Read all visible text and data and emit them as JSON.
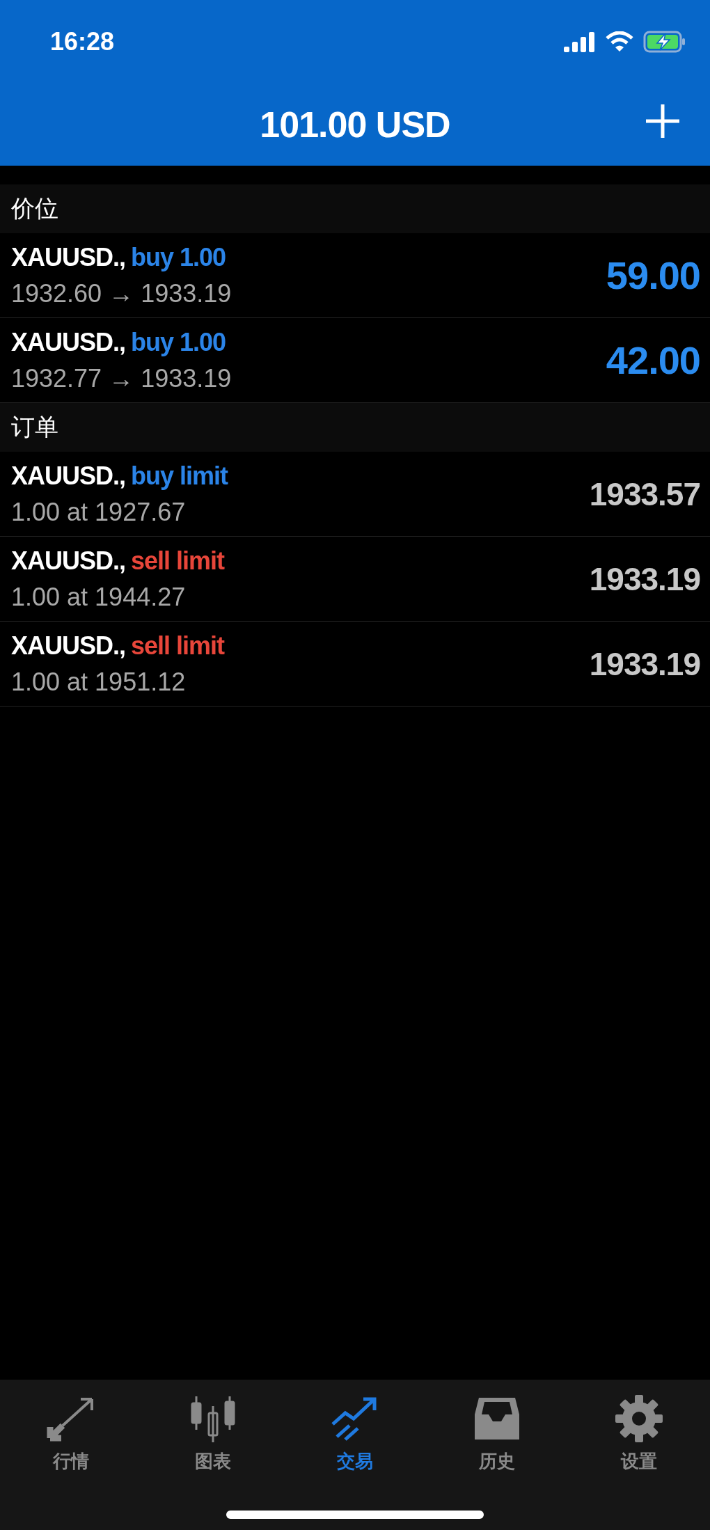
{
  "status_bar": {
    "time": "16:28",
    "battery_charging": true
  },
  "header": {
    "title": "101.00 USD"
  },
  "sections": [
    {
      "title": "价位",
      "rows": [
        {
          "symbol": "XAUUSD.,",
          "color": "#2b84e8",
          "action": "buy 1.00",
          "detail": "1932.60 → 1933.19",
          "value": "59.00",
          "kind": "position"
        },
        {
          "symbol": "XAUUSD.,",
          "color": "#2b84e8",
          "action": "buy 1.00",
          "detail": "1932.77 → 1933.19",
          "value": "42.00",
          "kind": "position"
        }
      ]
    },
    {
      "title": "订单",
      "rows": [
        {
          "symbol": "XAUUSD.,",
          "color": "#2b84e8",
          "action": "buy limit",
          "detail": "1.00 at 1927.67",
          "value": "1933.57",
          "kind": "order"
        },
        {
          "symbol": "XAUUSD.,",
          "color": "#e8463a",
          "action": "sell limit",
          "detail": "1.00 at 1944.27",
          "value": "1933.19",
          "kind": "order"
        },
        {
          "symbol": "XAUUSD.,",
          "color": "#e8463a",
          "action": "sell limit",
          "detail": "1.00 at 1951.12",
          "value": "1933.19",
          "kind": "order"
        }
      ]
    }
  ],
  "tabs": [
    {
      "label": "行情",
      "selected": false
    },
    {
      "label": "图表",
      "selected": false
    },
    {
      "label": "交易",
      "selected": true
    },
    {
      "label": "历史",
      "selected": false
    },
    {
      "label": "设置",
      "selected": false
    }
  ]
}
